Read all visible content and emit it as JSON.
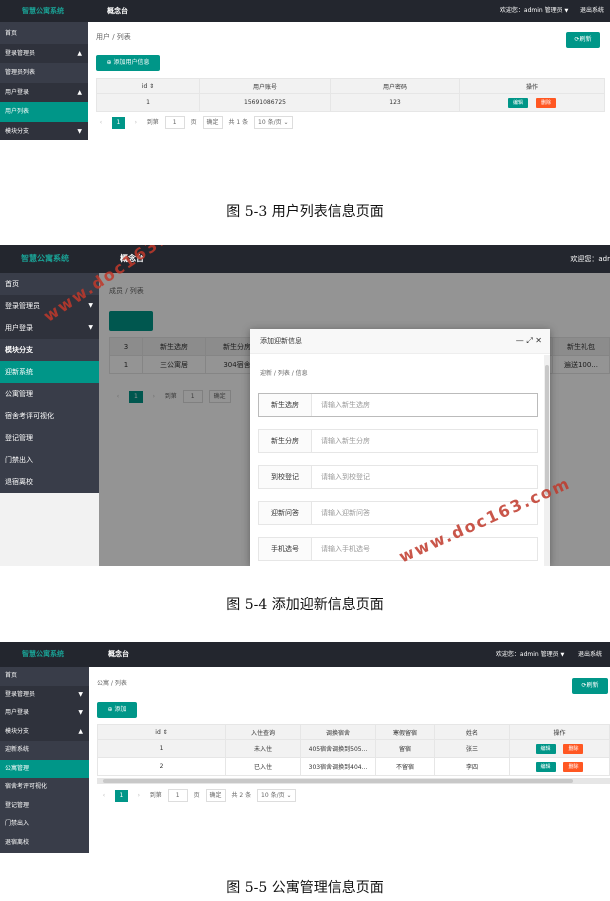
{
  "shot1": {
    "brand": "智慧公寓系统",
    "topnav": "概念台",
    "user_text": "欢迎您：admin 管理员",
    "logout": "退出系统",
    "sidebar": [
      {
        "label": "首页",
        "kind": "item",
        "arrow": ""
      },
      {
        "label": "登录管理员",
        "kind": "group",
        "arrow": "▲"
      },
      {
        "label": "管理员列表",
        "kind": "item",
        "arrow": ""
      },
      {
        "label": "用户登录",
        "kind": "group",
        "arrow": "▲"
      },
      {
        "label": "用户列表",
        "kind": "active",
        "arrow": ""
      },
      {
        "label": "模块分支",
        "kind": "group",
        "arrow": "▼"
      }
    ],
    "crumb": "用户  /  列表",
    "refresh": "⟳刷新",
    "add_button": "⊕ 添加用户信息",
    "headers": [
      "id ⇕",
      "用户账号",
      "用户密码",
      "操作"
    ],
    "rows": [
      [
        "1",
        "15691086725",
        "123"
      ]
    ],
    "edit": "编辑",
    "delete": "删除",
    "pager": {
      "prev": "‹",
      "page": "1",
      "next": "›",
      "goto": "到第",
      "page_input": "1",
      "page_unit": "页",
      "confirm": "确定",
      "total": "共 1 条",
      "per_page": "10 条/页 ⌄"
    },
    "caption": "图 5-3 用户列表信息页面"
  },
  "shot2": {
    "brand": "智慧公寓系统",
    "topnav": "概念台",
    "user_text": "欢迎您：adr",
    "sidebar": [
      {
        "label": "首页",
        "kind": "item",
        "arrow": ""
      },
      {
        "label": "登录管理员",
        "kind": "group",
        "arrow": "▼"
      },
      {
        "label": "用户登录",
        "kind": "group",
        "arrow": "▼"
      },
      {
        "label": "模块分支",
        "kind": "groupbold",
        "arrow": ""
      },
      {
        "label": "迎新系统",
        "kind": "active",
        "arrow": ""
      },
      {
        "label": "公寓管理",
        "kind": "item",
        "arrow": ""
      },
      {
        "label": "宿舍考评可视化",
        "kind": "item",
        "arrow": ""
      },
      {
        "label": "登记管理",
        "kind": "item",
        "arrow": ""
      },
      {
        "label": "门禁出入",
        "kind": "item",
        "arrow": ""
      },
      {
        "label": "退宿离校",
        "kind": "item",
        "arrow": ""
      }
    ],
    "crumb": "成员  /  列表",
    "bg_headers": [
      "3",
      "新生选房",
      "新生分房",
      "新生礼包"
    ],
    "bg_row": [
      "1",
      "三公寓居",
      "304宿舍",
      "遍送100..."
    ],
    "pager": {
      "prev": "‹",
      "page": "1",
      "next": "›",
      "goto": "到第",
      "page_input": "1",
      "confirm": "确定"
    },
    "modal": {
      "title": "添加迎新信息",
      "controls": "—  ⤢  ✕",
      "crumb": "迎新  /  列表  /  信息",
      "fields": [
        {
          "label": "新生选房",
          "placeholder": "请输入新生选房"
        },
        {
          "label": "新生分房",
          "placeholder": "请输入新生分房"
        },
        {
          "label": "到校登记",
          "placeholder": "请输入到校登记"
        },
        {
          "label": "迎新问答",
          "placeholder": "请输入迎新问答"
        },
        {
          "label": "手机选号",
          "placeholder": "请输入手机选号"
        }
      ]
    },
    "watermark": "www.doc163.com",
    "caption": "图 5-4 添加迎新信息页面"
  },
  "shot3": {
    "brand": "智慧公寓系统",
    "topnav": "概念台",
    "user_text": "欢迎您：admin 管理员",
    "logout": "退出系统",
    "sidebar": [
      {
        "label": "首页",
        "kind": "item",
        "arrow": ""
      },
      {
        "label": "登录管理员",
        "kind": "group",
        "arrow": "▼"
      },
      {
        "label": "用户登录",
        "kind": "group",
        "arrow": "▼"
      },
      {
        "label": "模块分支",
        "kind": "group",
        "arrow": "▲"
      },
      {
        "label": "迎新系统",
        "kind": "item",
        "arrow": ""
      },
      {
        "label": "公寓管理",
        "kind": "active",
        "arrow": ""
      },
      {
        "label": "宿舍考评可视化",
        "kind": "item",
        "arrow": ""
      },
      {
        "label": "登记管理",
        "kind": "item",
        "arrow": ""
      },
      {
        "label": "门禁出入",
        "kind": "item",
        "arrow": ""
      },
      {
        "label": "退宿离校",
        "kind": "item",
        "arrow": ""
      }
    ],
    "crumb": "公寓  /  列表",
    "refresh": "⟳刷新",
    "add_button": "⊕ 添加",
    "headers": [
      "id ⇕",
      "入住查询",
      "调换宿舍",
      "寒假留宿",
      "姓名",
      "操作"
    ],
    "rows": [
      [
        "1",
        "未入住",
        "405宿舍调换到505...",
        "留宿",
        "张三"
      ],
      [
        "2",
        "已入住",
        "303宿舍调换到404...",
        "不留宿",
        "李四"
      ]
    ],
    "edit": "编辑",
    "delete": "删除",
    "pager": {
      "prev": "‹",
      "page": "1",
      "next": "›",
      "goto": "到第",
      "page_input": "1",
      "page_unit": "页",
      "confirm": "确定",
      "total": "共 2 条",
      "per_page": "10 条/页 ⌄"
    },
    "caption": "图 5-5 公寓管理信息页面"
  }
}
